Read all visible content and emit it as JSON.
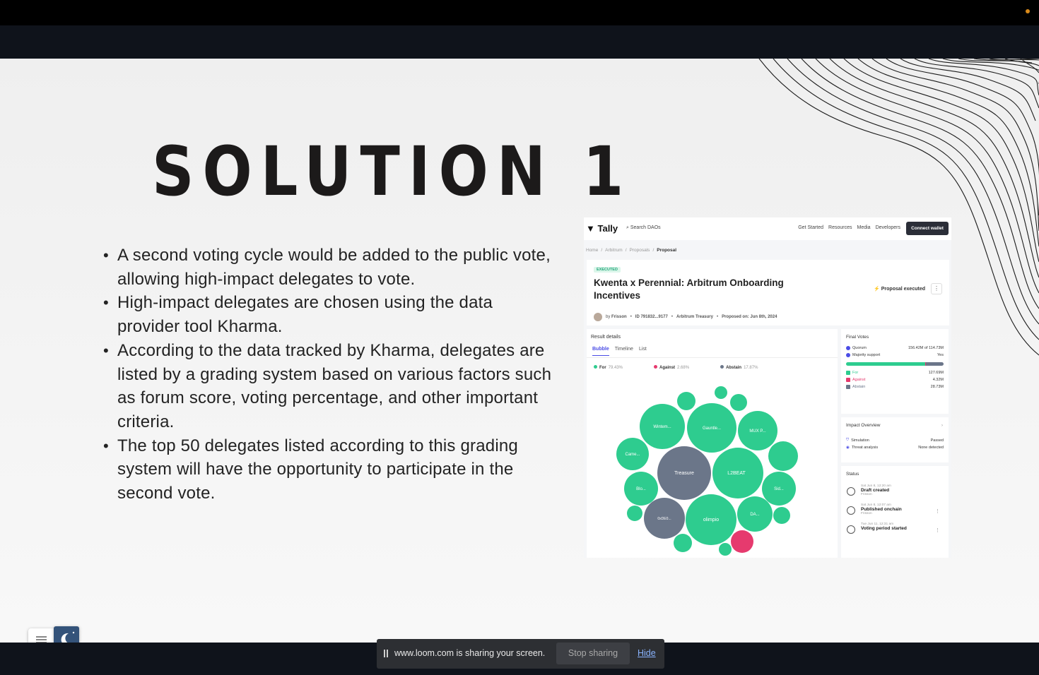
{
  "slide": {
    "title": "SOLUTION 1",
    "bullets": [
      "A second voting cycle would be added to the public vote, allowing high-impact delegates to vote.",
      "High-impact delegates are chosen using the data provider tool Kharma.",
      "According to the data tracked by Kharma, delegates are listed by a grading system based on various factors such as forum score, voting percentage, and other important criteria.",
      "The top 50 delegates listed according to this grading system will have the opportunity to participate in the second vote."
    ]
  },
  "tally": {
    "logo": "Tally",
    "search": "Search DAOs",
    "nav": [
      "Get Started",
      "Resources",
      "Media",
      "Developers"
    ],
    "connect": "Connect wallet",
    "breadcrumb": [
      "Home",
      "Arbitrum",
      "Proposals",
      "Proposal"
    ],
    "badge": "EXECUTED",
    "proposal_title": "Kwenta x Perennial: Arbitrum Onboarding Incentives",
    "status_executed": "Proposal executed",
    "meta": {
      "by": "by",
      "author": "Frisson",
      "id": "ID 791832...9177",
      "treasury": "Arbitrum Treasury",
      "proposed": "Proposed on: Jun 8th, 2024"
    },
    "results": {
      "title": "Result details",
      "tabs": [
        "Bubble",
        "Timeline",
        "List"
      ],
      "legend": [
        {
          "label": "For",
          "pct": "79.43%",
          "color": "#2ecc8f"
        },
        {
          "label": "Against",
          "pct": "2.68%",
          "color": "#e63a6e"
        },
        {
          "label": "Abstain",
          "pct": "17.87%",
          "color": "#6b7689"
        }
      ],
      "bubbles": [
        "Wintem...",
        "Gauntle...",
        "MUX P...",
        "Came...",
        "Treasure",
        "L2BEAT",
        "Blo...",
        "0xDE0...",
        "olimpio",
        "Sid...",
        "DA..."
      ]
    },
    "final_votes": {
      "title": "Final Votes",
      "quorum_label": "Quorum",
      "quorum_value": "156.42M of 114.73M",
      "majority_label": "Majority support",
      "majority_value": "Yes",
      "for_share": 0.81,
      "rows": [
        {
          "label": "For",
          "value": "127.69M",
          "color": "#2ecc8f"
        },
        {
          "label": "Against",
          "value": "4.32M",
          "color": "#e63a6e"
        },
        {
          "label": "Abstain",
          "value": "28.73M",
          "color": "#6b7689"
        }
      ]
    },
    "impact": {
      "title": "Impact Overview",
      "rows": [
        {
          "label": "Simulation",
          "value": "Passed"
        },
        {
          "label": "Threat analysis",
          "value": "None detected"
        }
      ]
    },
    "status": {
      "title": "Status",
      "items": [
        {
          "time": "Sat Jun 8, 12:20 am",
          "name": "Draft created",
          "by": "Frisson"
        },
        {
          "time": "Sat Jun 8, 12:07 am",
          "name": "Published onchain",
          "by": "Frisson"
        },
        {
          "time": "Tue Jun 11, 12:31 am",
          "name": "Voting period started",
          "by": ""
        }
      ]
    }
  },
  "sharebar": {
    "message": "www.loom.com is sharing your screen.",
    "stop": "Stop sharing",
    "hide": "Hide"
  }
}
